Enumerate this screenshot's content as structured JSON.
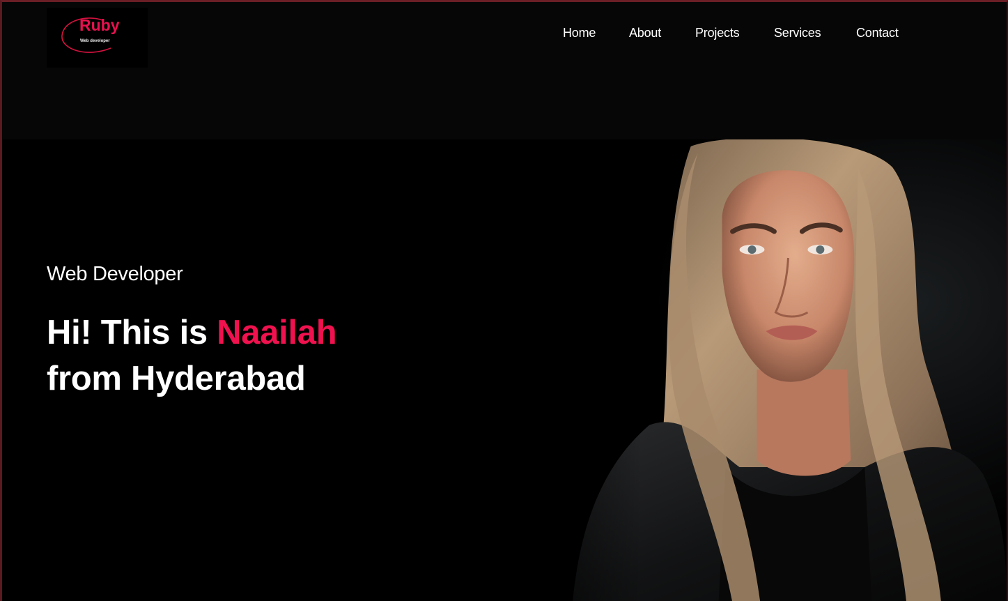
{
  "logo": {
    "title": "Ruby",
    "subtitle": "Web developer"
  },
  "nav": {
    "items": [
      {
        "label": "Home"
      },
      {
        "label": "About"
      },
      {
        "label": "Projects"
      },
      {
        "label": "Services"
      },
      {
        "label": "Contact"
      }
    ]
  },
  "hero": {
    "subtitle": "Web Developer",
    "headline_prefix": "Hi! This is ",
    "headline_name": "Naailah",
    "headline_line2": "from Hyderabad"
  },
  "colors": {
    "accent": "#f0114f",
    "background": "#000000",
    "text": "#ffffff"
  }
}
